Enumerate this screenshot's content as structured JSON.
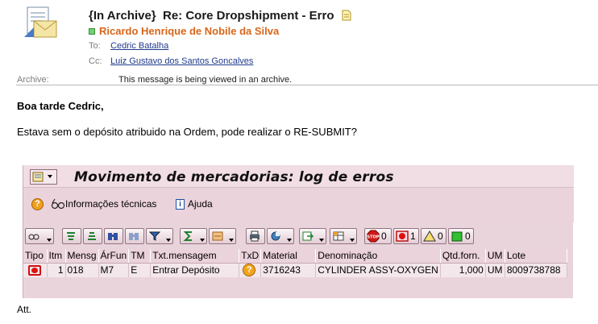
{
  "email": {
    "subject_prefix": "{In Archive}",
    "subject": "Re: Core Dropshipment - Erro",
    "sender": "Ricardo Henrique de Nobile da Silva",
    "to_label": "To:",
    "to": "Cedric Batalha",
    "cc_label": "Cc:",
    "cc": "Luiz Gustavo dos Santos Goncalves",
    "archive_label": "Archive:",
    "archive_message": "This message is being viewed in an archive."
  },
  "body": {
    "greeting": "Boa tarde Cedric,",
    "line": "Estava sem o depósito atribuido na Ordem, pode realizar o RE-SUBMIT?",
    "closing": "Att."
  },
  "sap": {
    "title": "Movimento de mercadorias: log de erros",
    "tech_info": "Informações técnicas",
    "help": "Ajuda",
    "counters": {
      "stop": "0",
      "error": "1",
      "warning": "0",
      "success": "0"
    },
    "columns": [
      "Tipo",
      "Itm",
      "Mensg",
      "ÁrFun",
      "TM",
      "Txt.mensagem",
      "TxD",
      "Material",
      "Denominação",
      "Qtd.forn.",
      "UM",
      "Lote"
    ],
    "rows": [
      {
        "itm": "1",
        "mensg": "018",
        "arfun": "M7",
        "tm": "E",
        "txt": "Entrar Depósito",
        "material": "3716243",
        "denominacao": "CYLINDER ASSY-OXYGEN",
        "qtd": "1,000",
        "um": "UM",
        "lote": "8009738788"
      }
    ]
  }
}
